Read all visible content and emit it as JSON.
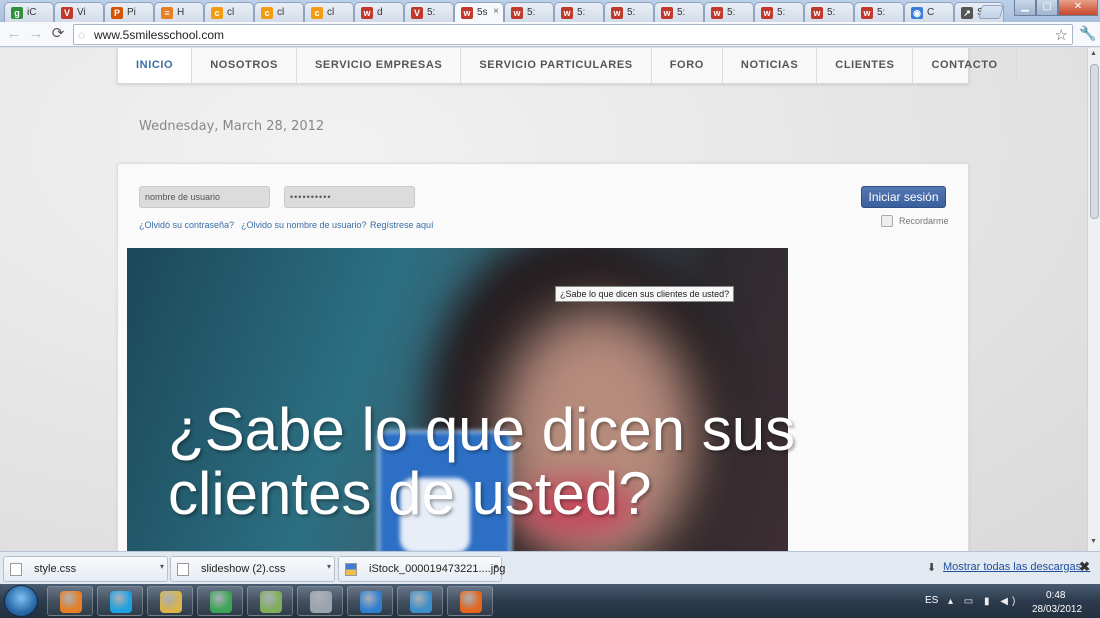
{
  "browser": {
    "tabs": [
      {
        "label": "iC",
        "color": "#2f8f3a",
        "glyph": "g"
      },
      {
        "label": "Vi",
        "color": "#c0392b",
        "glyph": "V"
      },
      {
        "label": "Pi",
        "color": "#d35400",
        "glyph": "P"
      },
      {
        "label": "H",
        "color": "#e67e22",
        "glyph": "≡"
      },
      {
        "label": "cl",
        "color": "#f39c12",
        "glyph": "c"
      },
      {
        "label": "cl",
        "color": "#f39c12",
        "glyph": "c"
      },
      {
        "label": "cl",
        "color": "#f39c12",
        "glyph": "c"
      },
      {
        "label": "d",
        "color": "#c0392b",
        "glyph": "w"
      },
      {
        "label": "5:",
        "color": "#c0392b",
        "glyph": "V"
      },
      {
        "label": "5s",
        "color": "#c0392b",
        "glyph": "w",
        "active": true
      },
      {
        "label": "5:",
        "color": "#c0392b",
        "glyph": "w"
      },
      {
        "label": "5:",
        "color": "#c0392b",
        "glyph": "w"
      },
      {
        "label": "5:",
        "color": "#c0392b",
        "glyph": "w"
      },
      {
        "label": "5:",
        "color": "#c0392b",
        "glyph": "w"
      },
      {
        "label": "5:",
        "color": "#c0392b",
        "glyph": "w"
      },
      {
        "label": "5:",
        "color": "#c0392b",
        "glyph": "w"
      },
      {
        "label": "5:",
        "color": "#c0392b",
        "glyph": "w"
      },
      {
        "label": "5:",
        "color": "#c0392b",
        "glyph": "w"
      },
      {
        "label": "C",
        "color": "#3b7dd8",
        "glyph": "◉"
      },
      {
        "label": "SI",
        "color": "#555555",
        "glyph": "↗"
      }
    ],
    "tab_close_glyph": "×",
    "url": "www.5smilesschool.com",
    "icons": {
      "back": "←",
      "forward": "→",
      "reload": "⟳",
      "globe": "◌",
      "star": "☆",
      "wrench": "🔧",
      "minimize": "▁",
      "maximize": "▢",
      "close": "✕"
    }
  },
  "site": {
    "nav": [
      "INICIO",
      "NOSOTROS",
      "SERVICIO EMPRESAS",
      "SERVICIO PARTICULARES",
      "FORO",
      "NOTICIAS",
      "CLIENTES",
      "CONTACTO"
    ],
    "active_nav": "INICIO",
    "date": "Wednesday, March 28, 2012",
    "login": {
      "username_placeholder": "nombre de usuario",
      "password_value": "••••••••••",
      "forgot_password": "¿Olvidó su contraseña?",
      "forgot_username": "¿Olvido su nombre de usuario?",
      "register": "Regístrese aquí",
      "submit": "Iniciar sesión",
      "remember": "Recordarme"
    },
    "slide": {
      "tooltip": "¿Sabe lo que dicen sus clientes de usted?",
      "headline": "¿Sabe lo que dicen sus clientes de usted?"
    }
  },
  "downloads": {
    "items": [
      "style.css",
      "slideshow (2).css",
      "iStock_000019473221....jpg"
    ],
    "show_all": "Mostrar todas las descargas...",
    "download_icon": "⬇",
    "close_glyph": "✖",
    "caret": "▾"
  },
  "taskbar": {
    "apps": [
      {
        "name": "media-player",
        "color": "#e67e22"
      },
      {
        "name": "skype",
        "color": "#1ea1e0"
      },
      {
        "name": "file-explorer",
        "color": "#d9b44a"
      },
      {
        "name": "chrome",
        "color": "#3aa655"
      },
      {
        "name": "recycle",
        "color": "#7fae5a"
      },
      {
        "name": "disc",
        "color": "#9aa4ad"
      },
      {
        "name": "internet-explorer",
        "color": "#2f7fd1"
      },
      {
        "name": "app-a",
        "color": "#3c8fc9"
      },
      {
        "name": "firefox",
        "color": "#e2661f"
      }
    ],
    "language": "ES",
    "tray_glyphs": "▴ ▭ ▮ ◀)",
    "time": "0:48",
    "date": "28/03/2012"
  },
  "colors": {
    "accent": "#3c6ea6",
    "login_button": "#3a5f9d",
    "link": "#3a6ea5"
  }
}
